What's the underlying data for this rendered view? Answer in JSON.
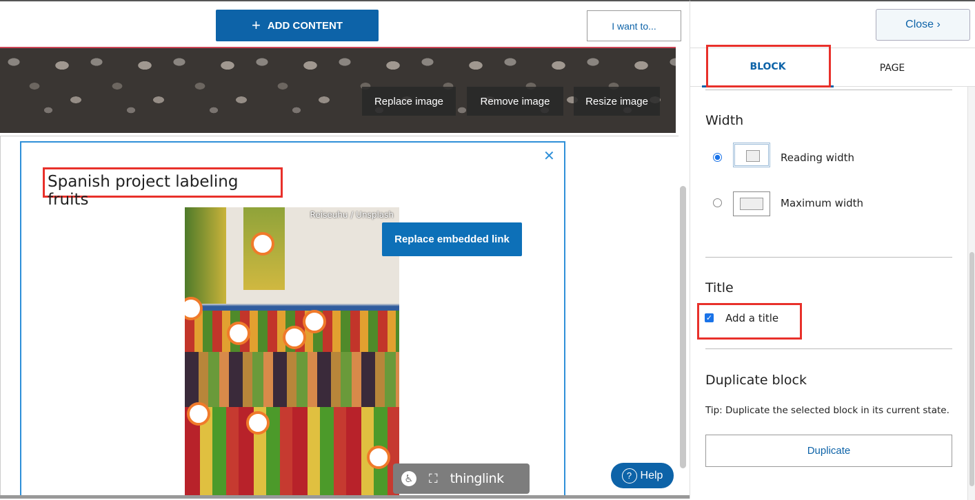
{
  "toolbar": {
    "add_content": "ADD CONTENT",
    "add_icon": "plus-icon",
    "i_want_to": "I want to..."
  },
  "banner": {
    "replace_image": "Replace image",
    "remove_image": "Remove image",
    "resize_image": "Resize image"
  },
  "block": {
    "title": "Spanish project labeling fruits",
    "close_icon": "close-icon",
    "image_credit": "Reiseuhu / Unsplash",
    "replace_embedded_link": "Replace embedded link",
    "thinglink_logo": "thinglink",
    "hotspot_count": 9
  },
  "help": {
    "label": "Help",
    "icon": "?"
  },
  "panel": {
    "close": "Close ›",
    "tabs": [
      {
        "label": "BLOCK",
        "active": true
      },
      {
        "label": "PAGE",
        "active": false
      }
    ],
    "width": {
      "heading": "Width",
      "options": [
        {
          "label": "Reading width",
          "selected": true
        },
        {
          "label": "Maximum width",
          "selected": false
        }
      ]
    },
    "title": {
      "heading": "Title",
      "checkbox_label": "Add a title",
      "checked": true
    },
    "duplicate": {
      "heading": "Duplicate block",
      "tip": "Tip: Duplicate the selected block in its current state.",
      "button": "Duplicate"
    }
  },
  "colors": {
    "primary": "#0d63a8",
    "highlight": "#e8302a",
    "hotspot": "#f07a2a"
  }
}
